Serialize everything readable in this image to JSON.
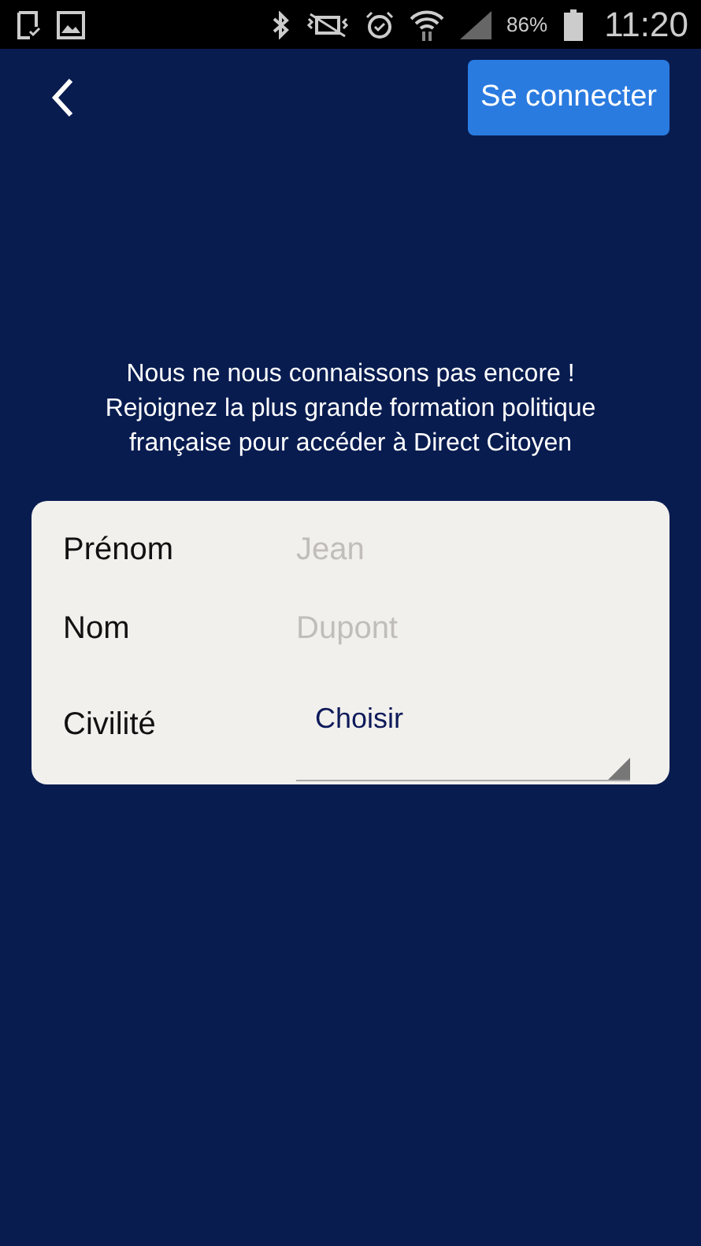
{
  "status_bar": {
    "battery": "86%",
    "time": "11:20"
  },
  "header": {
    "login_button": "Se connecter"
  },
  "intro": [
    "Nous ne nous connaissons pas encore !",
    "Rejoignez la plus grande formation politique",
    "française pour accéder à Direct Citoyen"
  ],
  "form": {
    "fields": [
      {
        "kind": "text",
        "label": "Prénom",
        "placeholder": "Jean"
      },
      {
        "kind": "text",
        "label": "Nom",
        "placeholder": "Dupont"
      },
      {
        "kind": "select",
        "label": "Civilité",
        "value": "Choisir"
      }
    ]
  }
}
